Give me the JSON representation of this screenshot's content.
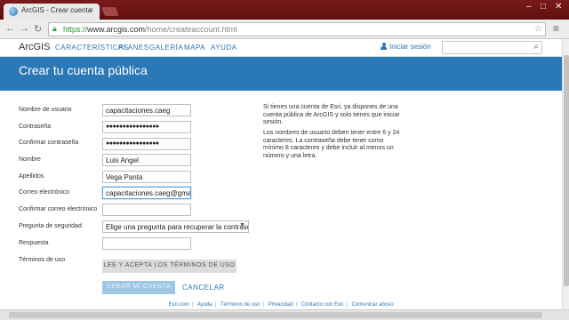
{
  "browser": {
    "tab_title": "ArcGIS - Crear cuenta",
    "tab_close": "×",
    "url_secure": "https://",
    "url_host": "www.arcgis.com",
    "url_path": "/home/createaccount.html",
    "win_min": "–",
    "win_max": "□",
    "win_close": "✕",
    "back": "←",
    "forward": "→",
    "reload": "↻",
    "star": "☆",
    "menu": "≡"
  },
  "header": {
    "logo": "ArcGIS",
    "nav": [
      "CARACTERÍSTICAS",
      "PLANES",
      "GALERÍA",
      "MAPA",
      "AYUDA"
    ],
    "signin": "Iniciar sesión",
    "search_icon": "⌕"
  },
  "banner": {
    "title": "Crear tu cuenta pública"
  },
  "form": {
    "username_label": "Nombre de usuario",
    "username_value": "capacitaciones.caeg",
    "password_label": "Contraseña",
    "password_value": "●●●●●●●●●●●●●●●●",
    "confirm_password_label": "Confirmar contraseña",
    "confirm_password_value": "●●●●●●●●●●●●●●●●",
    "name_label": "Nombre",
    "name_value": "Luis Angel",
    "lastname_label": "Apellidos",
    "lastname_value": "Vega Panta",
    "email_label": "Correo electrónico",
    "email_value": "capacitaciones.caeg@gmail",
    "confirm_email_label": "Confirmar correo electrónico",
    "confirm_email_value": "",
    "question_label": "Pregunta de seguridad",
    "question_value": "Elige una pregunta para recuperar la contraseña",
    "answer_label": "Respuesta",
    "answer_value": "",
    "terms_label": "Términos de uso",
    "terms_button": "LEE Y ACEPTA LOS TÉRMINOS DE USO",
    "create_button": "CREAR MI CUENTA",
    "cancel_link": "CANCELAR"
  },
  "help": {
    "p1": "Si tienes una cuenta de Esri, ya dispones de una cuenta pública de ArcGIS y solo tienes que iniciar sesión.",
    "p2": "Los nombres de usuario deben tener entre 6 y 24 caracteres. La contraseña debe tener como mínimo 8 caracteres y debe incluir al menos un número y una letra."
  },
  "footer": {
    "links": [
      "Esri.com",
      "Ayuda",
      "Términos de uso",
      "Privacidad",
      "Contacto con Esri",
      "Comunicar abuso"
    ]
  },
  "colors": {
    "accent": "#2a78b5",
    "link": "#2a76b5",
    "tabbar": "#6b1414"
  }
}
